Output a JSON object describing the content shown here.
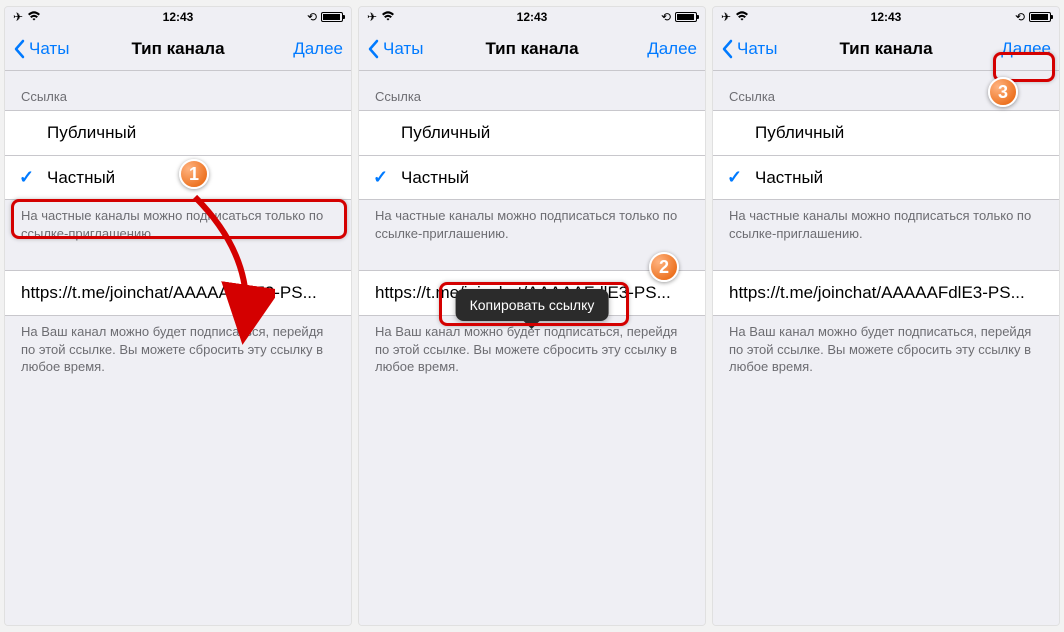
{
  "status": {
    "time": "12:43"
  },
  "nav": {
    "back": "Чаты",
    "title": "Тип канала",
    "next": "Далее"
  },
  "section_link": "Ссылка",
  "options": {
    "public": "Публичный",
    "private": "Частный"
  },
  "footer1": "На частные каналы можно подписаться только по ссылке-приглашению.",
  "invite_link": "https://t.me/joinchat/AAAAAFdlE3-PS...",
  "footer2": "На Ваш канал можно будет подписаться, перейдя по этой ссылке. Вы можете сбросить эту ссылку в любое время.",
  "context_menu": "Копировать ссылку",
  "badges": {
    "b1": "1",
    "b2": "2",
    "b3": "3"
  }
}
